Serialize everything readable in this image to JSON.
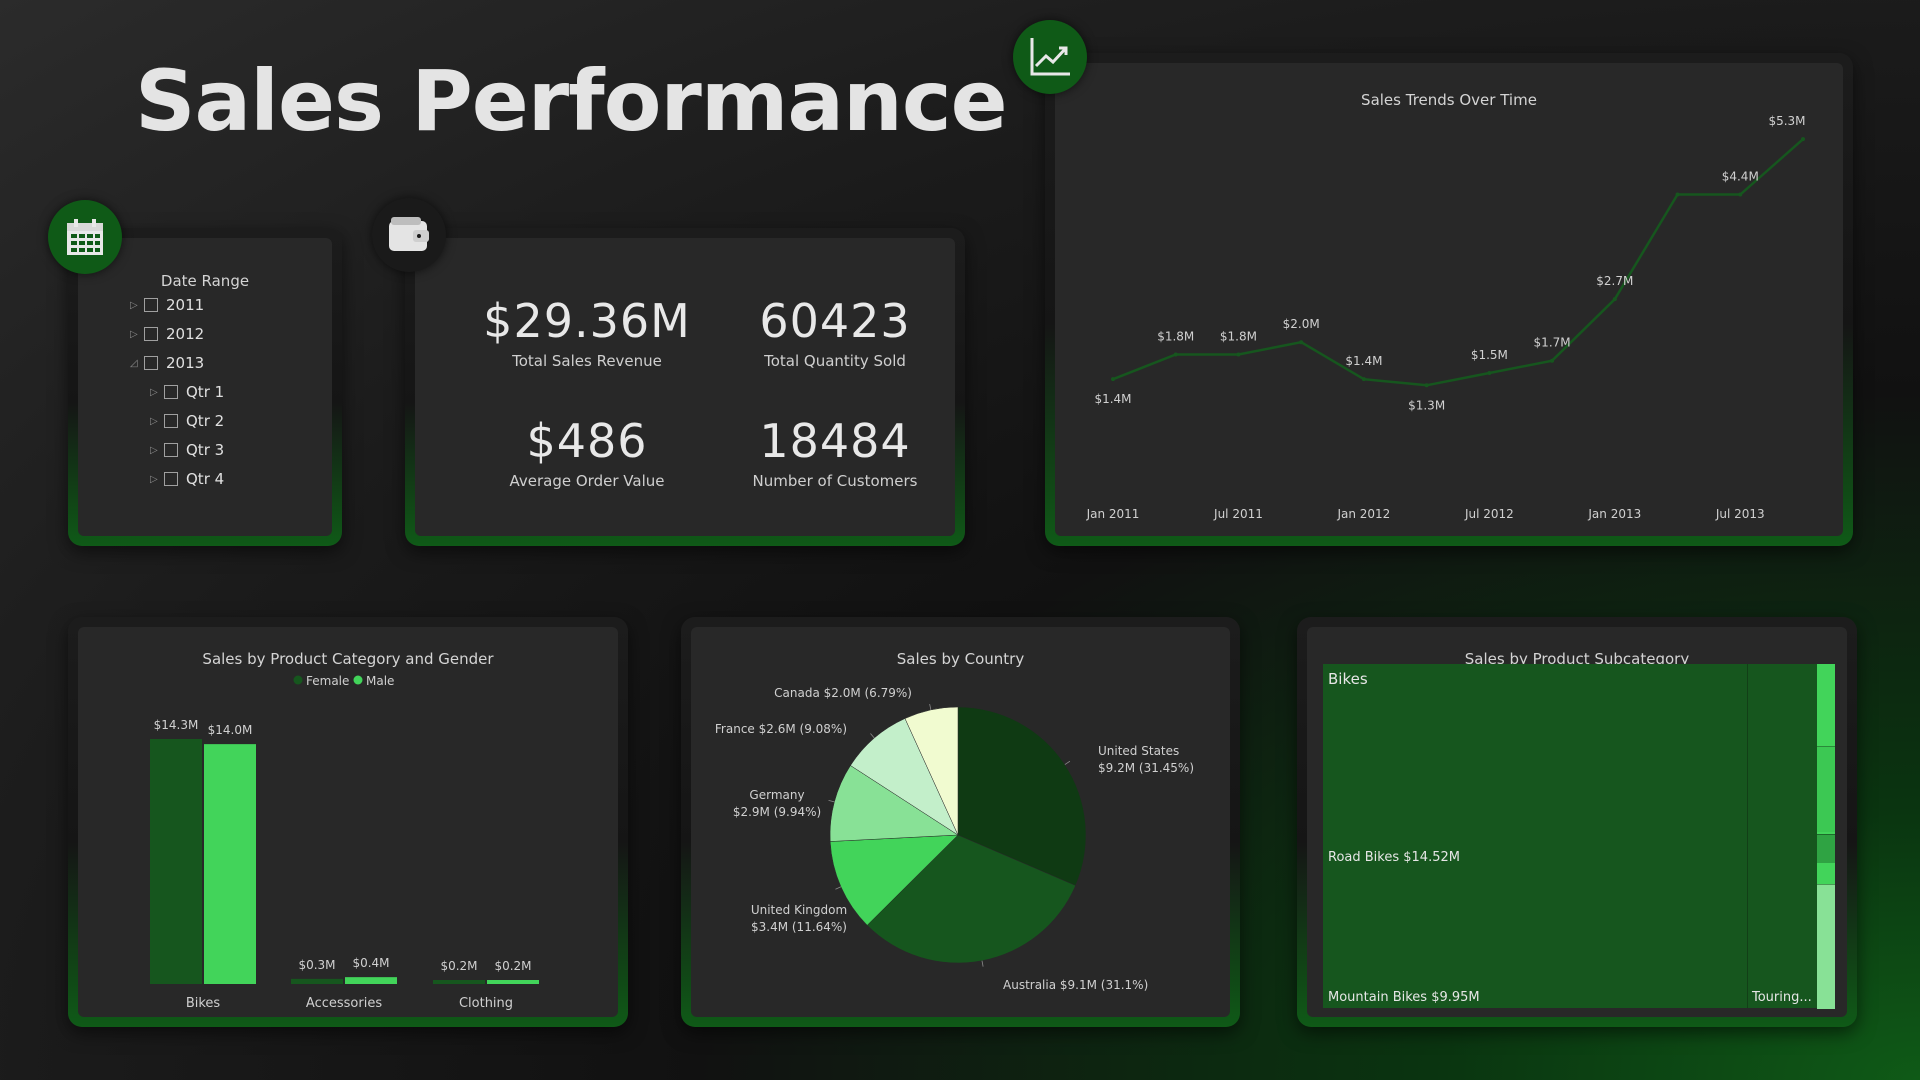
{
  "title": "Sales Performance",
  "colors": {
    "accent": "#0f5a17",
    "female": "#16561e",
    "male": "#42d45a",
    "line": "#16561e"
  },
  "date_slicer": {
    "title": "Date Range",
    "items": [
      {
        "label": "2011",
        "expanded": false,
        "level": 0
      },
      {
        "label": "2012",
        "expanded": false,
        "level": 0
      },
      {
        "label": "2013",
        "expanded": true,
        "level": 0
      },
      {
        "label": "Qtr 1",
        "expanded": false,
        "level": 1
      },
      {
        "label": "Qtr 2",
        "expanded": false,
        "level": 1
      },
      {
        "label": "Qtr 3",
        "expanded": false,
        "level": 1
      },
      {
        "label": "Qtr 4",
        "expanded": false,
        "level": 1
      }
    ]
  },
  "kpis": [
    {
      "value": "$29.36M",
      "label": "Total Sales Revenue"
    },
    {
      "value": "60423",
      "label": "Total Quantity Sold"
    },
    {
      "value": "$486",
      "label": "Average Order Value"
    },
    {
      "value": "18484",
      "label": "Number of Customers"
    }
  ],
  "icons": {
    "calendar": "calendar-icon",
    "wallet": "wallet-icon",
    "trend": "trend-chart-icon"
  },
  "chart_data": [
    {
      "type": "line",
      "title": "Sales Trends Over Time",
      "x": [
        "Jan 2011",
        "Apr 2011",
        "Jul 2011",
        "Oct 2011",
        "Jan 2012",
        "Apr 2012",
        "Jul 2012",
        "Oct 2012",
        "Jan 2013",
        "Apr 2013",
        "Jul 2013",
        "Oct 2013"
      ],
      "x_ticks": [
        "Jan 2011",
        "Jul 2011",
        "Jan 2012",
        "Jul 2012",
        "Jan 2013",
        "Jul 2013"
      ],
      "values": [
        1.4,
        1.8,
        1.8,
        2.0,
        1.4,
        1.3,
        1.5,
        1.7,
        2.7,
        4.4,
        4.4,
        5.3
      ],
      "point_labels": [
        "$1.4M",
        "$1.8M",
        "$1.8M",
        "$2.0M",
        "$1.4M",
        "$1.3M",
        "$1.5M",
        "$1.7M",
        "$2.7M",
        "",
        "$4.4M",
        "$5.3M"
      ],
      "grid": false
    },
    {
      "type": "bar",
      "title": "Sales by Product Category and Gender",
      "categories": [
        "Bikes",
        "Accessories",
        "Clothing"
      ],
      "series": [
        {
          "name": "Female",
          "values": [
            14.3,
            0.3,
            0.2
          ],
          "labels": [
            "$14.3M",
            "$0.3M",
            "$0.2M"
          ]
        },
        {
          "name": "Male",
          "values": [
            14.0,
            0.4,
            0.2
          ],
          "labels": [
            "$14.0M",
            "$0.4M",
            "$0.2M"
          ]
        }
      ],
      "legend": "top-center"
    },
    {
      "type": "pie",
      "title": "Sales by Country",
      "slices": [
        {
          "label": "United States",
          "value": 9.2,
          "percent": 31.45,
          "text": "$9.2M (31.45%)",
          "color": "#0f3a13"
        },
        {
          "label": "Australia",
          "value": 9.1,
          "percent": 31.1,
          "text": "$9.1M (31.1%)",
          "color": "#16561e"
        },
        {
          "label": "United Kingdom",
          "value": 3.4,
          "percent": 11.64,
          "text": "$3.4M (11.64%)",
          "color": "#42d45a"
        },
        {
          "label": "Germany",
          "value": 2.9,
          "percent": 9.94,
          "text": "$2.9M (9.94%)",
          "color": "#88e196"
        },
        {
          "label": "France",
          "value": 2.6,
          "percent": 9.08,
          "text": "$2.6M (9.08%)",
          "color": "#c3efca"
        },
        {
          "label": "Canada",
          "value": 2.0,
          "percent": 6.79,
          "text": "$2.0M (6.79%)",
          "color": "#f1fbd0"
        }
      ]
    },
    {
      "type": "treemap",
      "title": "Sales by Product Subcategory",
      "group": "Bikes",
      "items": [
        {
          "label": "Road Bikes $14.52M",
          "value": 14.52
        },
        {
          "label": "Mountain Bikes $9.95M",
          "value": 9.95
        },
        {
          "label": "Touring...",
          "value": 3.84
        }
      ]
    }
  ]
}
